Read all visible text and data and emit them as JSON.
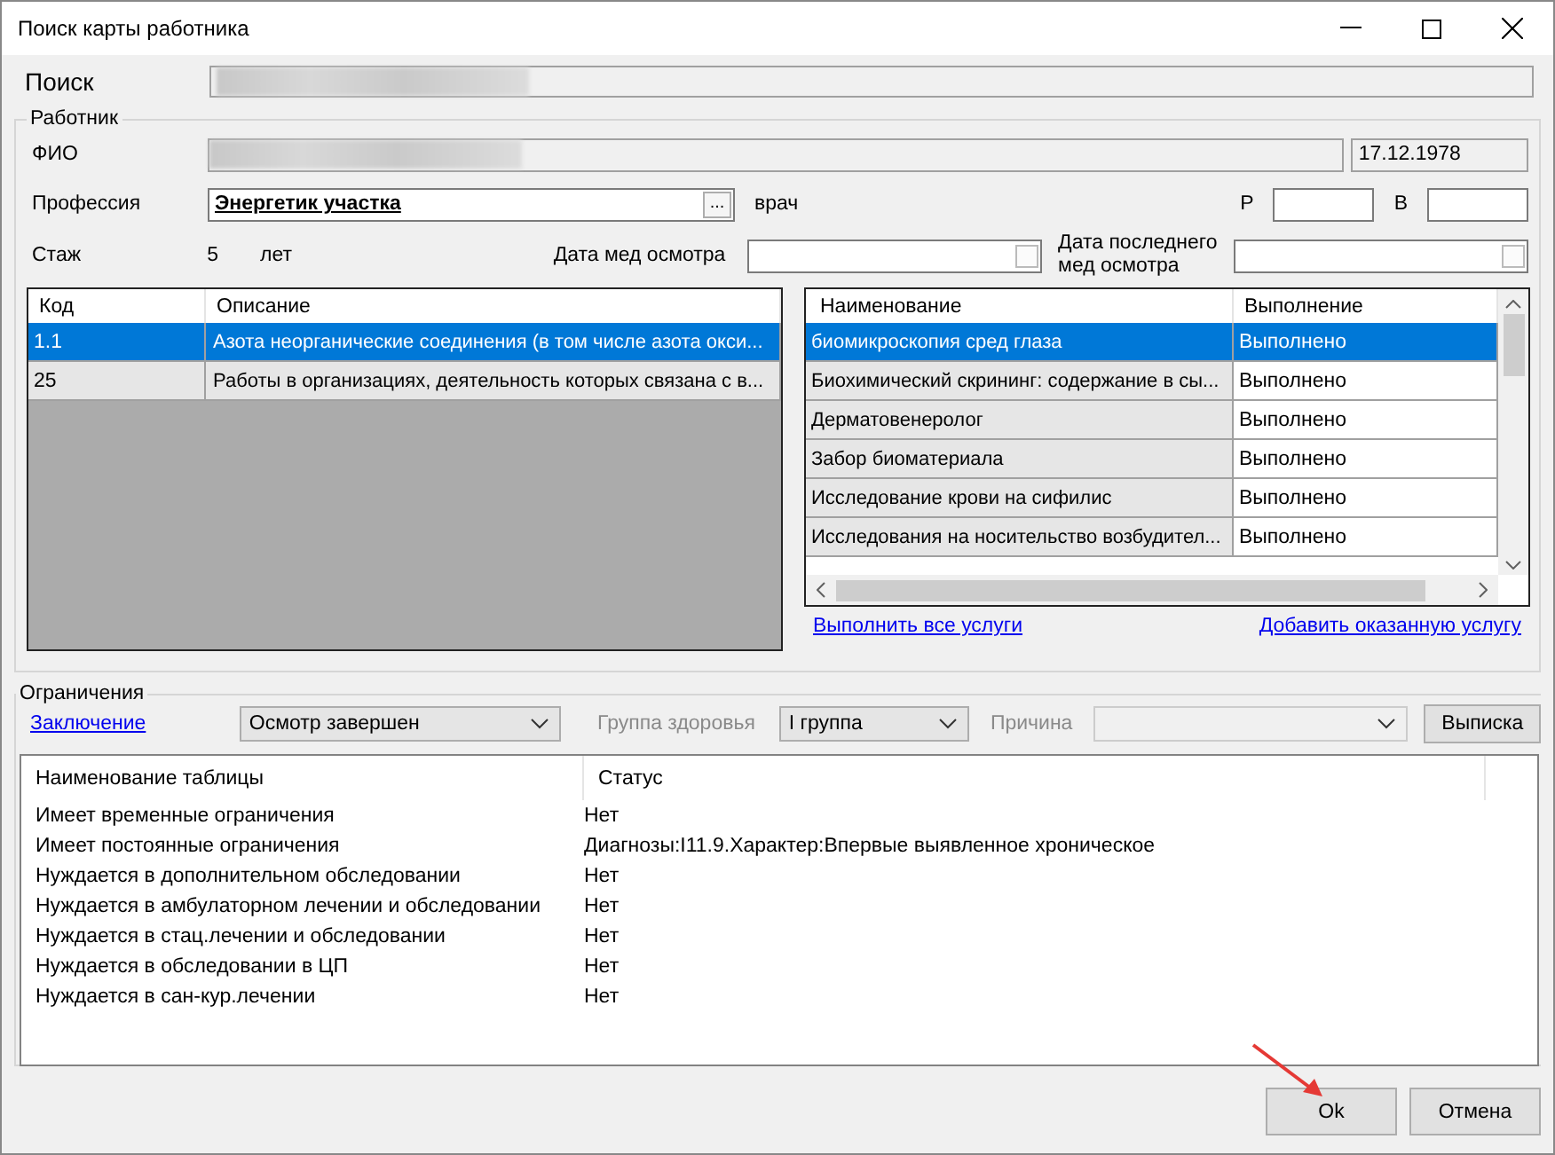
{
  "window": {
    "title": "Поиск карты работника"
  },
  "search": {
    "label": "Поиск"
  },
  "worker": {
    "legend": "Работник",
    "fio_label": "ФИО",
    "birth_date": "17.12.1978",
    "profession_label": "Профессия",
    "profession": "Энергетик участка",
    "browse_button": "...",
    "profession_type": "врач",
    "r_label": "Р",
    "v_label": "В",
    "experience_label": "Стаж",
    "experience": "5",
    "experience_unit": "лет",
    "exam_date_label": "Дата мед осмотра",
    "exam_date_checked": false,
    "last_exam_date_label": "Дата последнего мед осмотра",
    "last_exam_date_checked": false
  },
  "factors": {
    "columns": [
      "Код",
      "Описание"
    ],
    "rows": [
      {
        "code": "1.1",
        "description": "Азота неорганические соединения (в том числе азота окси...",
        "selected": true
      },
      {
        "code": "25",
        "description": "Работы в организациях, деятельность которых связана с в...",
        "selected": false
      }
    ]
  },
  "services": {
    "columns": [
      "Наименование",
      "Выполнение"
    ],
    "rows": [
      {
        "name": "биомикроскопия сред глаза",
        "status": "Выполнено",
        "selected": true
      },
      {
        "name": "Биохимический скрининг: содержание в сы...",
        "status": "Выполнено",
        "selected": false
      },
      {
        "name": "Дерматовенеролог",
        "status": "Выполнено",
        "selected": false
      },
      {
        "name": "Забор биоматериала",
        "status": "Выполнено",
        "selected": false
      },
      {
        "name": "Исследование крови на сифилис",
        "status": "Выполнено",
        "selected": false
      },
      {
        "name": "Исследования на носительство возбудител...",
        "status": "Выполнено",
        "selected": false
      }
    ],
    "links": [
      "Выполнить все услуги",
      "Добавить оказанную услугу"
    ]
  },
  "restrictions": {
    "legend": "Ограничения",
    "conclusion_link": "Заключение",
    "status_combo": {
      "value": "Осмотр завершен",
      "disabled": false
    },
    "health_group_label": "Группа здоровья",
    "health_group_combo": {
      "value": "I группа",
      "disabled": false
    },
    "reason_label": "Причина",
    "reason_combo": {
      "disabled": true
    },
    "extract_button": "Выписка",
    "columns": [
      "Наименование таблицы",
      "Статус"
    ],
    "rows": [
      {
        "name": "Имеет временные ограничения",
        "status": "Нет"
      },
      {
        "name": "Имеет постоянные ограничения",
        "status": "Диагнозы:I11.9.Характер:Впервые выявленное хроническое"
      },
      {
        "name": "Нуждается в дополнительном обследовании",
        "status": "Нет"
      },
      {
        "name": "Нуждается в амбулаторном лечении и обследовании",
        "status": "Нет"
      },
      {
        "name": "Нуждается в стац.лечении и обследовании",
        "status": "Нет"
      },
      {
        "name": "Нуждается в обследовании в ЦП",
        "status": "Нет"
      },
      {
        "name": "Нуждается в сан-кур.лечении",
        "status": "Нет"
      }
    ]
  },
  "buttons": [
    "Ok",
    "Отмена"
  ]
}
